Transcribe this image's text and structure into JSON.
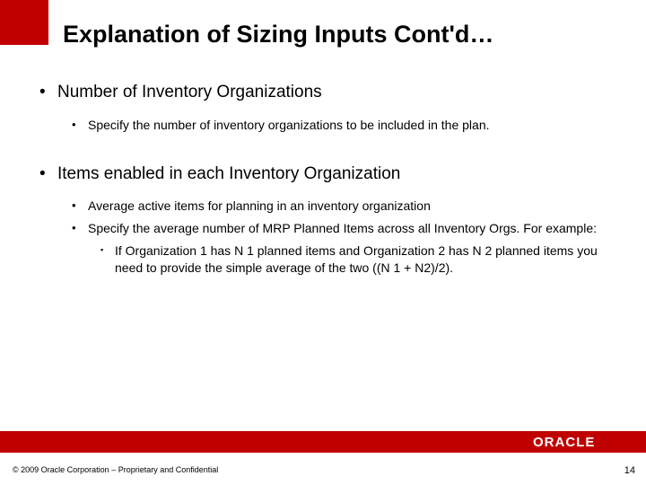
{
  "title": "Explanation of Sizing Inputs Cont'd…",
  "bullets": {
    "a": "Number of Inventory Organizations",
    "a1": "Specify the number of inventory organizations to be included in the plan.",
    "b": "Items enabled in each Inventory Organization",
    "b1": "Average active items for planning in an inventory organization",
    "b2": "Specify the average number of MRP Planned Items across all Inventory Orgs. For example:",
    "b2a": "If Organization 1 has N 1 planned items and Organization 2 has N 2 planned items  you need to provide the simple average of the two ((N 1 + N2)/2)."
  },
  "footer": {
    "copyright": "© 2009 Oracle Corporation – Proprietary and Confidential",
    "page": "14",
    "logo_text": "ORACLE"
  }
}
